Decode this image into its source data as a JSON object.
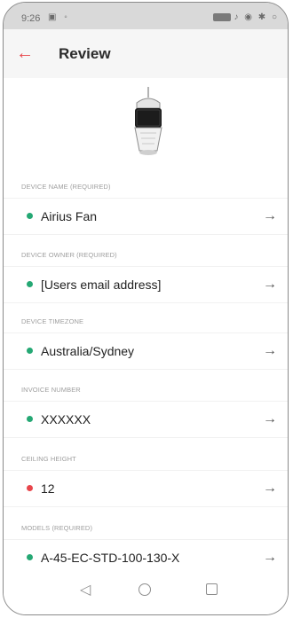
{
  "status_bar": {
    "time": "9:26",
    "left_icons": "▣ ◦",
    "right_icons": "♪ ◉ ✱ ○"
  },
  "header": {
    "back_icon": "arrow-left-icon",
    "title": "Review"
  },
  "colors": {
    "accent": "#e8454b",
    "status_ok": "#25a874",
    "status_error": "#e8454b"
  },
  "fields": [
    {
      "label": "DEVICE NAME (REQUIRED)",
      "value": "Airius Fan",
      "status": "ok"
    },
    {
      "label": "DEVICE OWNER (REQUIRED)",
      "value": "[Users email address]",
      "status": "ok"
    },
    {
      "label": "DEVICE TIMEZONE",
      "value": "Australia/Sydney",
      "status": "ok"
    },
    {
      "label": "INVOICE NUMBER",
      "value": "XXXXXX",
      "status": "ok"
    },
    {
      "label": "CEILING HEIGHT",
      "value": "12",
      "status": "error"
    },
    {
      "label": "MODELS (REQUIRED)",
      "value": "A-45-EC-STD-100-130-X",
      "status": "ok"
    }
  ],
  "nav_bar": {
    "back_icon": "triangle-back-icon",
    "home_icon": "circle-home-icon",
    "recents_icon": "square-recents-icon"
  }
}
